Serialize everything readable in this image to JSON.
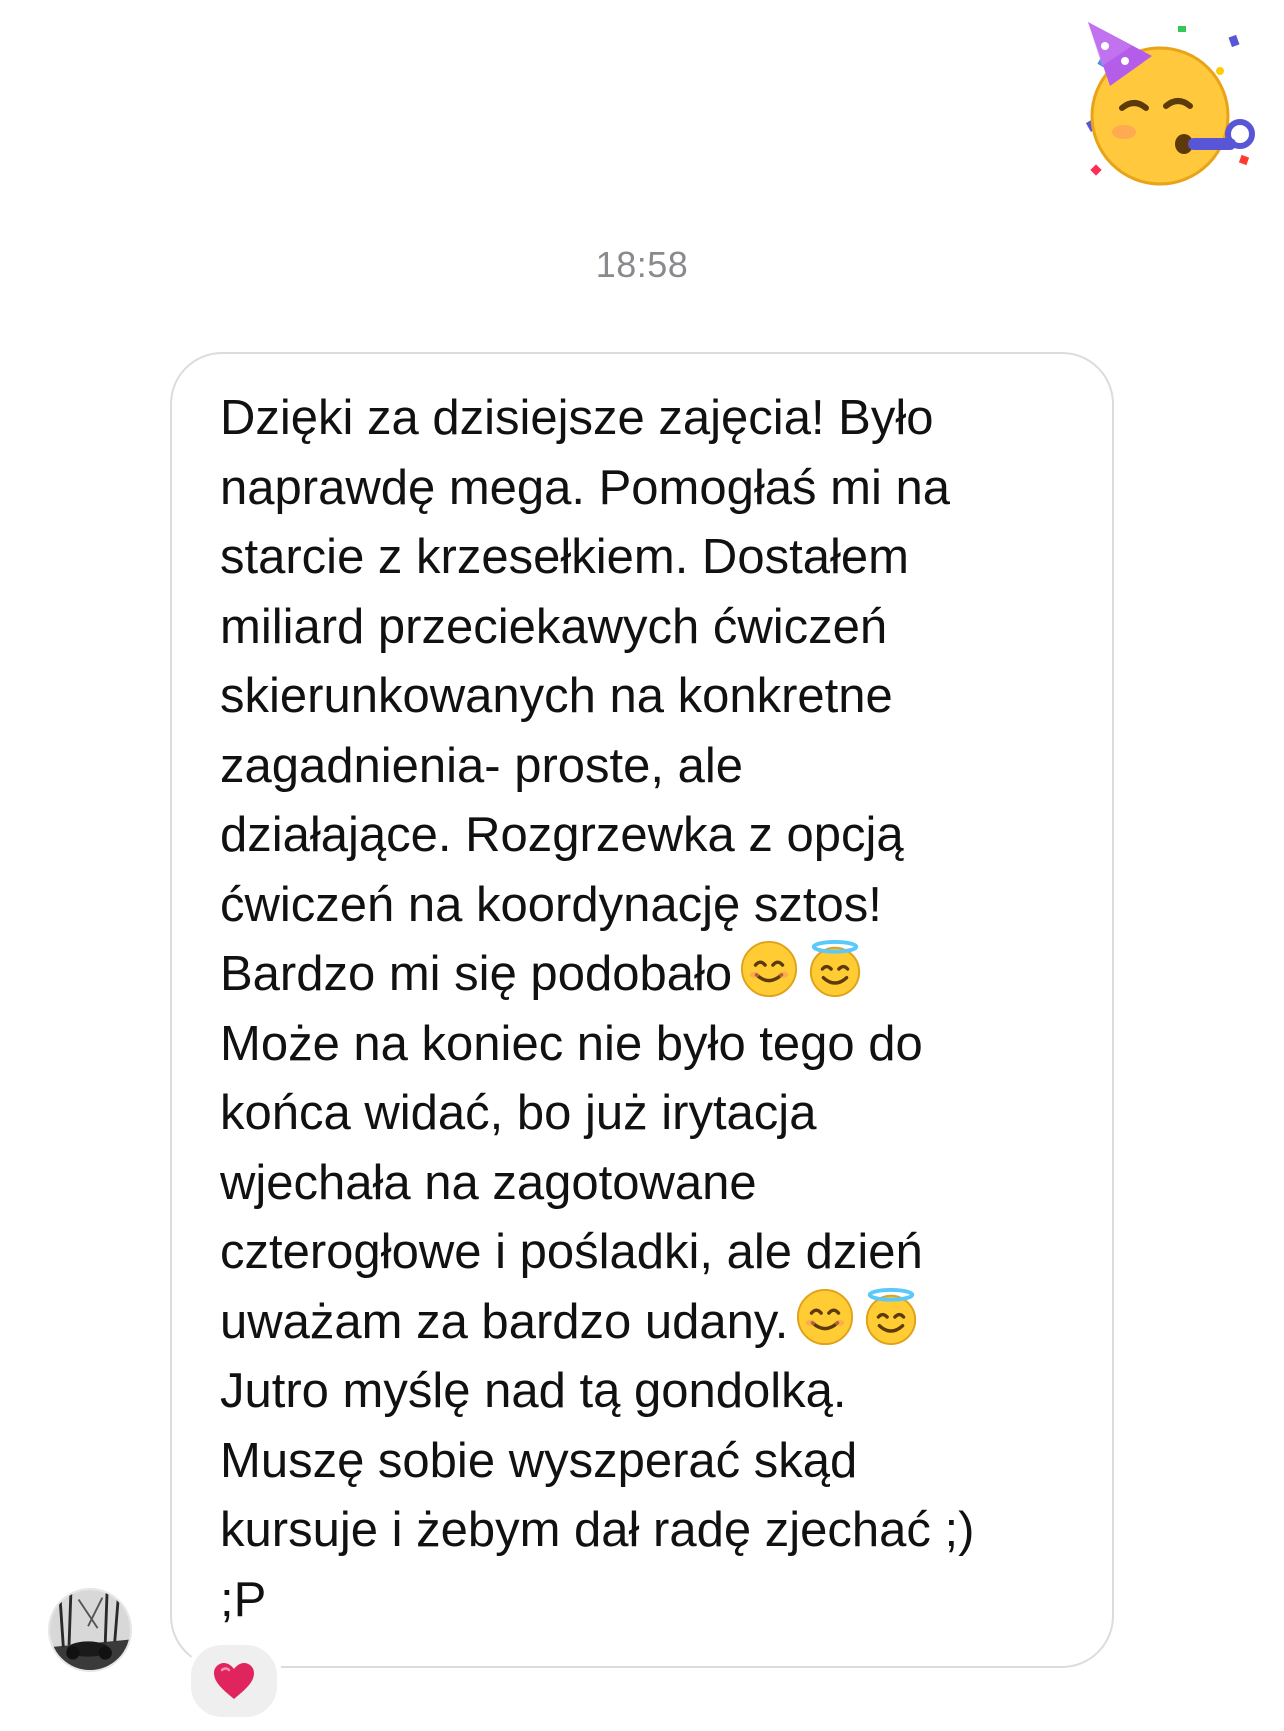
{
  "header": {
    "sticker_icon": "partying-face-icon"
  },
  "conversation": {
    "timestamp": "18:58",
    "sender": {
      "avatar_icon": "avatar"
    },
    "message": {
      "lines": [
        "Dzięki za dzisiejsze zajęcia! Było",
        "naprawdę mega. Pomogłaś mi na",
        "starcie z krzesełkiem. Dostałem",
        "miliard przeciekawych ćwiczeń",
        "skierunkowanych na konkretne",
        "zagadnienia- proste, ale",
        "działające. Rozgrzewka z opcją",
        "ćwiczeń na koordynację sztos!",
        "Bardzo mi się podobało",
        "Może na koniec nie było tego do",
        "końca widać, bo już irytacja",
        "wjechała na zagotowane",
        "czterogłowe i pośladki, ale dzień",
        "uważam za bardzo udany.",
        "Jutro myślę nad tą gondolką.",
        "Muszę sobie wyszperać skąd",
        "kursuje i żebym dał radę zjechać ;)",
        ";P"
      ],
      "emoji": [
        "smiling-face-icon",
        "halo-face-icon"
      ]
    },
    "reaction": {
      "emoji": "heart-icon",
      "color": "#e0245e"
    }
  },
  "colors": {
    "bubble_border": "#dcdcdc",
    "timestamp": "#8a8a8e",
    "reaction_bg": "#efefef",
    "text": "#111111"
  }
}
